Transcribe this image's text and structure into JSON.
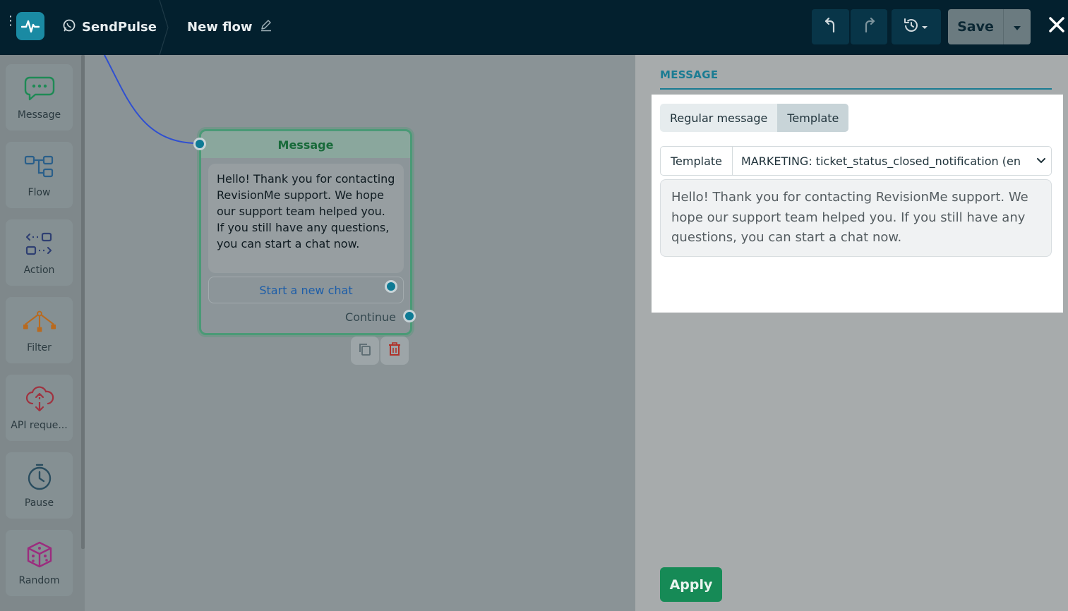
{
  "header": {
    "brand": "SendPulse",
    "flow_title": "New flow",
    "save_label": "Save"
  },
  "sidebar": {
    "items": [
      {
        "label": "Message",
        "icon": "chat-bubble-icon",
        "color": "#1e8a55"
      },
      {
        "label": "Flow",
        "icon": "flow-icon",
        "color": "#2a5f8a"
      },
      {
        "label": "Action",
        "icon": "action-icon",
        "color": "#2f3f72"
      },
      {
        "label": "Filter",
        "icon": "filter-icon",
        "color": "#b96a1f"
      },
      {
        "label": "API reque...",
        "icon": "api-cloud-icon",
        "color": "#a0323f"
      },
      {
        "label": "Pause",
        "icon": "clock-icon",
        "color": "#2a4d5f"
      },
      {
        "label": "Random",
        "icon": "dice-icon",
        "color": "#9b2c7e"
      }
    ]
  },
  "node": {
    "title": "Message",
    "text": "Hello! Thank you for contacting RevisionMe support. We hope our support team helped you. If you still have any questions, you can start a chat now.",
    "button_label": "Start a new chat",
    "continue_label": "Continue"
  },
  "panel": {
    "title": "MESSAGE",
    "tabs": [
      {
        "label": "Regular message",
        "active": false
      },
      {
        "label": "Template",
        "active": true
      }
    ],
    "template_label": "Template",
    "template_value": "MARKETING: ticket_status_closed_notification (en",
    "preview_text": "Hello! Thank you for contacting RevisionMe support. We hope our support team helped you. If you still have any questions, you can start a chat now.",
    "apply_label": "Apply"
  }
}
